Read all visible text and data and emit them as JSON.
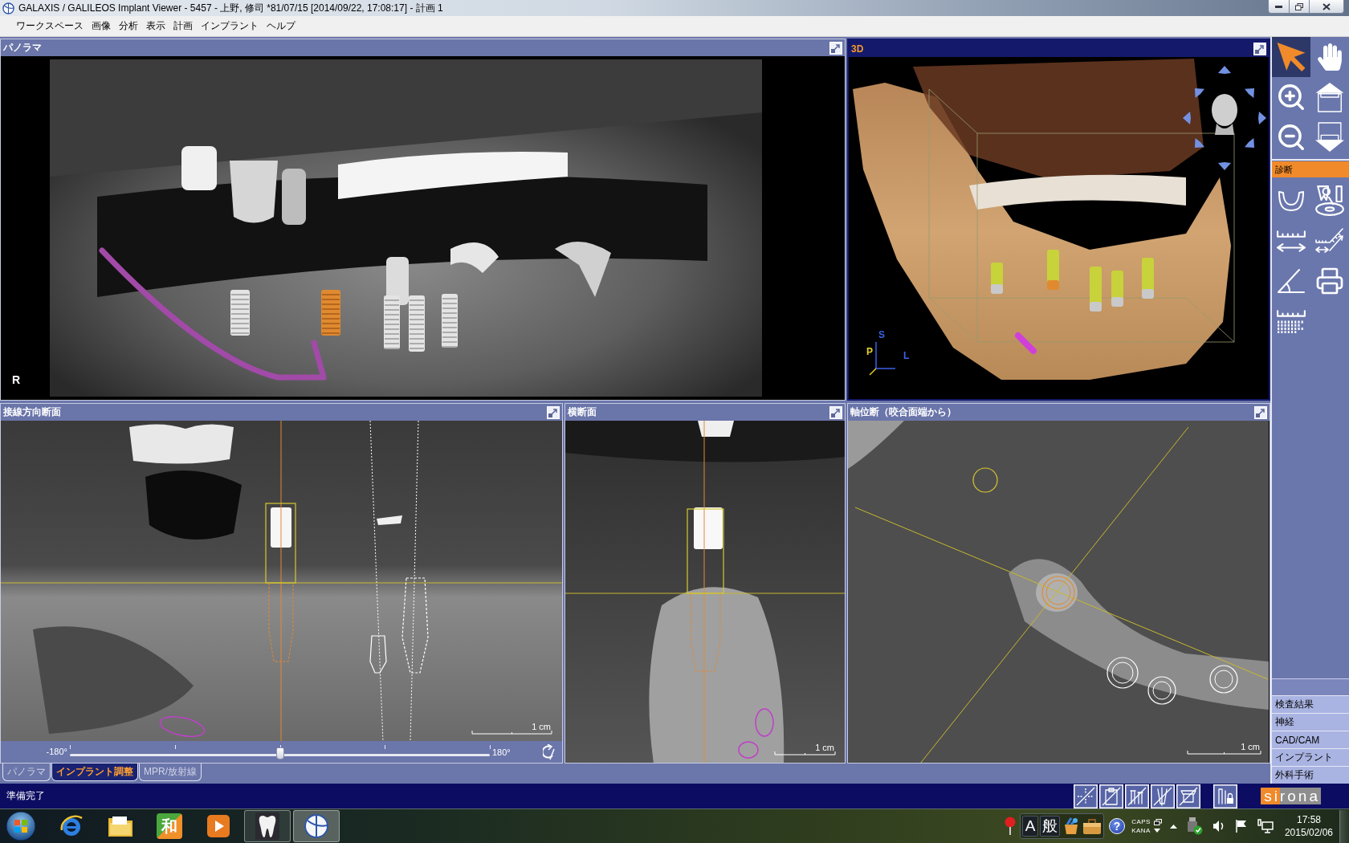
{
  "window": {
    "title": "GALAXIS / GALILEOS Implant Viewer - 5457 - 上野, 修司 *81/07/15 [2014/09/22, 17:08:17] - 計画 1"
  },
  "menu": [
    "ワークスペース",
    "画像",
    "分析",
    "表示",
    "計画",
    "インプラント",
    "ヘルプ"
  ],
  "panels": [
    {
      "kind": "panorama",
      "title": "パノラマ",
      "selected": false,
      "orientation": "R"
    },
    {
      "kind": "volume",
      "title": "3D",
      "selected": true,
      "axes": [
        {
          "text": "S",
          "color": "#3a62e6"
        },
        {
          "text": "P",
          "color": "#e6d22a"
        },
        {
          "text": "L",
          "color": "#3a62e6"
        }
      ]
    },
    {
      "kind": "tangential",
      "title": "接線方向断面",
      "selected": false,
      "scale": "1 cm",
      "slider": {
        "min": "-180°",
        "max": "180°",
        "level": 0.5
      }
    },
    {
      "kind": "cross",
      "title": "横断面",
      "selected": false,
      "scale": "1 cm"
    },
    {
      "kind": "axial",
      "title": "軸位断（咬合面端から）",
      "selected": false,
      "scale": "1 cm"
    }
  ],
  "tabs": [
    {
      "label": "パノラマ",
      "selected": false
    },
    {
      "label": "インプラント調整",
      "selected": true
    },
    {
      "label": "MPR/放射線",
      "selected": false
    }
  ],
  "toolbar": {
    "tools": [
      {
        "kind": "pointer",
        "selected": true
      },
      {
        "kind": "hand",
        "selected": false
      },
      {
        "kind": "zoom-in",
        "selected": false
      },
      {
        "kind": "page-up",
        "selected": false
      },
      {
        "kind": "zoom-out",
        "selected": false
      },
      {
        "kind": "page-down",
        "selected": false
      }
    ],
    "section": "診断",
    "section_tools": [
      {
        "kind": "arch"
      },
      {
        "kind": "tooth-disc"
      },
      {
        "kind": "ruler"
      },
      {
        "kind": "angled-ruler"
      },
      {
        "kind": "angle"
      },
      {
        "kind": "printer"
      },
      {
        "kind": "dotted-ruler"
      }
    ],
    "views": [
      "検査結果",
      "神経",
      "CAD/CAM",
      "インプラント",
      "外科手術"
    ]
  },
  "status_bar": {
    "text": "準備完了",
    "tools": [
      {
        "kind": "crosshair"
      },
      {
        "kind": "clipboard"
      },
      {
        "kind": "implants"
      },
      {
        "kind": "implant-axis"
      },
      {
        "kind": "sleeve"
      },
      {
        "kind": "implants-lock"
      }
    ],
    "logo": "sirona"
  },
  "taskbar": {
    "apps": [
      {
        "kind": "browser",
        "running": false,
        "selected": false
      },
      {
        "kind": "folder",
        "running": false,
        "selected": false
      },
      {
        "kind": "ime-tool",
        "glyph": "和",
        "running": false,
        "selected": false
      },
      {
        "kind": "media",
        "running": false,
        "selected": false
      },
      {
        "kind": "tooth",
        "running": true,
        "selected": false
      },
      {
        "kind": "galaxis",
        "running": true,
        "selected": true
      }
    ],
    "ime": [
      "A",
      "般"
    ],
    "help": "?",
    "indicators": [
      "CAPS",
      "KANA"
    ],
    "clock": {
      "time": "17:58",
      "date": "2015/02/06"
    }
  }
}
